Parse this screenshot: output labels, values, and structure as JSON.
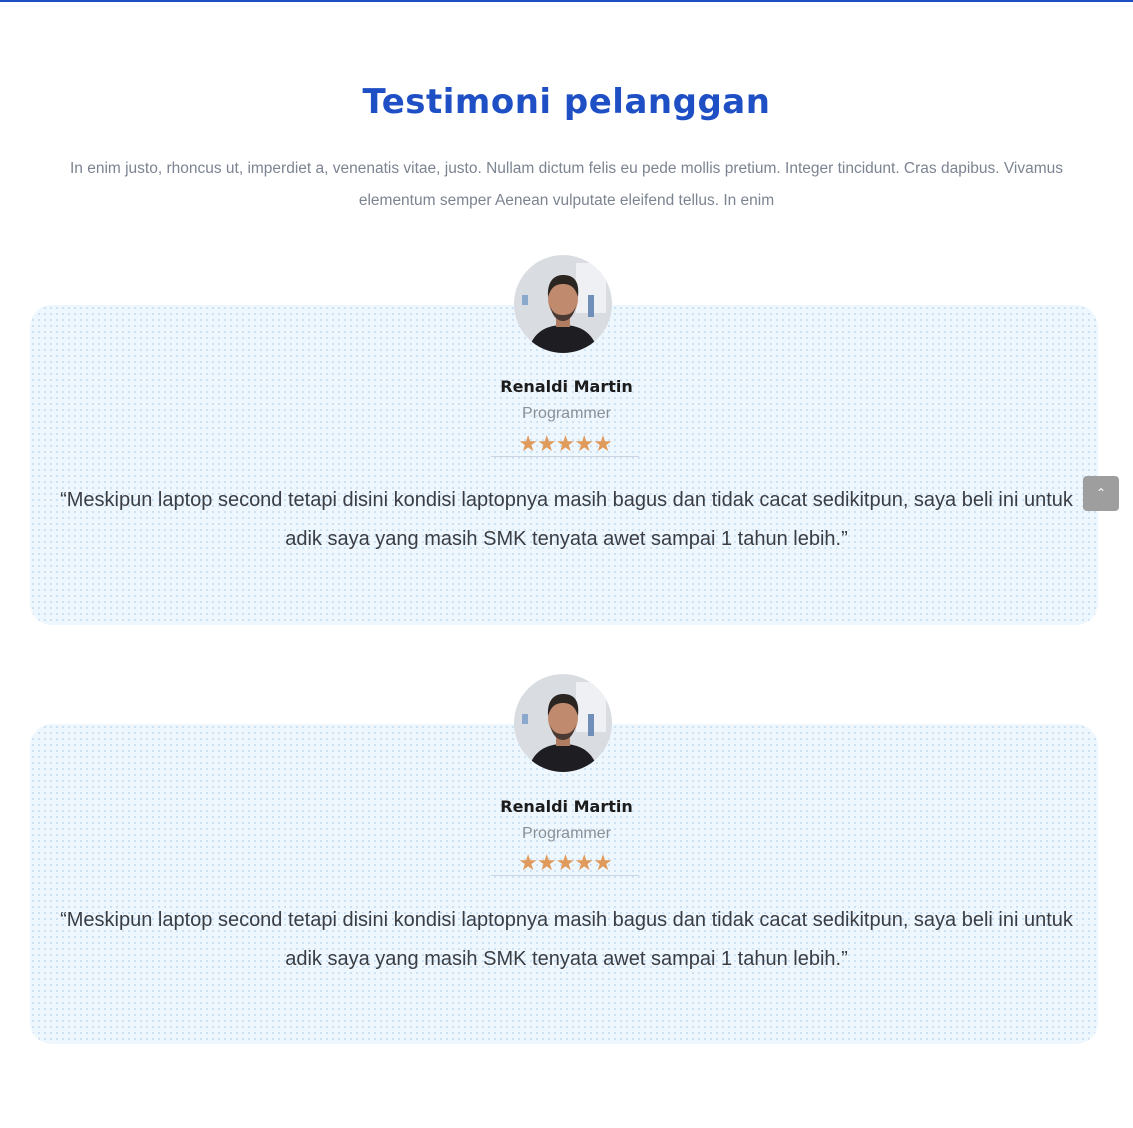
{
  "section": {
    "title": "Testimoni pelanggan",
    "intro": "In enim justo, rhoncus ut, imperdiet a, venenatis vitae, justo. Nullam dictum felis eu pede mollis pretium. Integer tincidunt. Cras dapibus. Vivamus elementum semper Aenean vulputate eleifend tellus. In enim"
  },
  "testimonials": [
    {
      "name": "Renaldi Martin",
      "role": "Programmer",
      "rating": 5,
      "stars": "★★★★★",
      "quote": "“Meskipun laptop second tetapi disini kondisi laptopnya masih bagus dan tidak cacat sedikitpun, saya beli ini untuk adik saya yang masih SMK tenyata awet sampai 1 tahun lebih.”"
    },
    {
      "name": "Renaldi Martin",
      "role": "Programmer",
      "rating": 5,
      "stars": "★★★★★",
      "quote": "“Meskipun laptop second tetapi disini kondisi laptopnya masih bagus dan tidak cacat sedikitpun, saya beli ini untuk adik saya yang masih SMK tenyata awet sampai 1 tahun lebih.”"
    }
  ],
  "scroll_top": {
    "icon": "chevron-up-icon",
    "glyph": "⌃"
  },
  "colors": {
    "accent": "#1f4fc4",
    "star": "#e09a5b",
    "card_bg": "#eef7fe"
  }
}
